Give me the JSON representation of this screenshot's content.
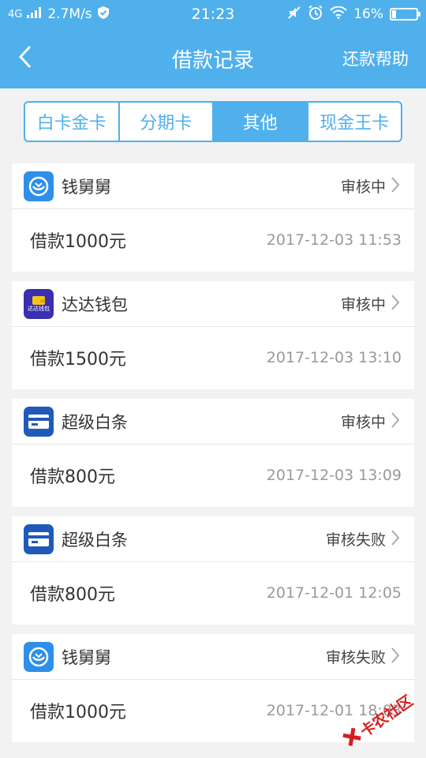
{
  "status_bar": {
    "network": "4G",
    "speed": "2.7M/s",
    "time": "21:23",
    "battery": "16%",
    "battery_level": 0.16
  },
  "nav": {
    "title": "借款记录",
    "right_label": "还款帮助"
  },
  "tabs": [
    {
      "label": "白卡金卡",
      "active": false
    },
    {
      "label": "分期卡",
      "active": false
    },
    {
      "label": "其他",
      "active": true
    },
    {
      "label": "现金王卡",
      "active": false
    }
  ],
  "records": [
    {
      "app": "钱舅舅",
      "icon": "qianjiujiu-icon",
      "status": "审核中",
      "amount": "借款1000元",
      "time": "2017-12-03 11:53"
    },
    {
      "app": "达达钱包",
      "icon": "dada-wallet-icon",
      "icon_text": "达达钱包",
      "status": "审核中",
      "amount": "借款1500元",
      "time": "2017-12-03 13:10"
    },
    {
      "app": "超级白条",
      "icon": "card-icon",
      "status": "审核中",
      "amount": "借款800元",
      "time": "2017-12-03 13:09"
    },
    {
      "app": "超级白条",
      "icon": "card-icon",
      "status": "审核失败",
      "amount": "借款800元",
      "time": "2017-12-01 12:05"
    },
    {
      "app": "钱舅舅",
      "icon": "qianjiujiu-icon",
      "status": "审核失败",
      "amount": "借款1000元",
      "time": "2017-12-01 18:03"
    }
  ],
  "watermark": {
    "text": "卡农社区"
  },
  "colors": {
    "primary": "#4fb0ec",
    "qianjiujiu": "#2f8fe8",
    "dada": "#3a2fb0",
    "card": "#1f5ab8",
    "watermark": "#d52020"
  }
}
